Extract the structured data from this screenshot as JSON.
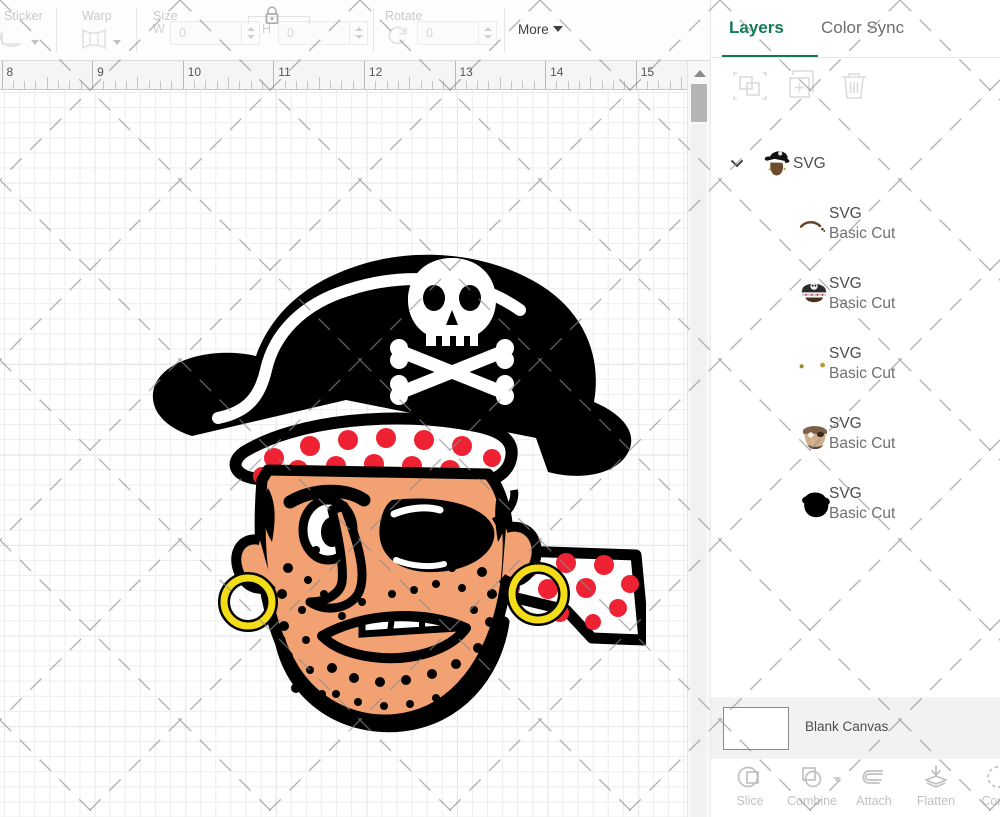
{
  "toolbar": {
    "groups": [
      {
        "label": "Sticker",
        "icon": "sticker-icon",
        "has_caret": true
      },
      {
        "label": "Warp",
        "icon": "warp-icon",
        "has_caret": true
      },
      {
        "label": "Size",
        "icon": "lock-icon"
      },
      {
        "label": "Rotate",
        "icon": "rotate-icon"
      }
    ],
    "size": {
      "label": "Size",
      "width_letter": "W",
      "width_value": "0",
      "height_letter": "H",
      "height_value": "0",
      "lock_icon": "lock-closed-icon"
    },
    "rotate": {
      "label": "Rotate",
      "value": "0",
      "icon": "rotate-icon"
    },
    "more_label": "More"
  },
  "ruler": {
    "unit": "inches",
    "marks": [
      "8",
      "9",
      "10",
      "11",
      "12",
      "13",
      "14",
      "15"
    ]
  },
  "canvas": {
    "artwork_name": "pirate-head-svg",
    "colors": {
      "skin": "#F2A172",
      "black": "#000000",
      "white": "#FFFFFF",
      "red": "#EE2233",
      "gold": "#F3DD18"
    }
  },
  "panel": {
    "tabs": [
      {
        "label": "Layers",
        "active": true
      },
      {
        "label": "Color Sync",
        "active": false
      }
    ],
    "actions": [
      {
        "name": "group-button",
        "icon": "group-icon",
        "enabled": false
      },
      {
        "name": "duplicate-button",
        "icon": "duplicate-icon",
        "enabled": false
      },
      {
        "name": "delete-button",
        "icon": "trash-icon",
        "enabled": false
      }
    ],
    "layers": [
      {
        "title": "SVG",
        "subtitle": "",
        "type": "group",
        "expanded": true,
        "thumb": "pirate-head-thumb"
      },
      {
        "title": "SVG",
        "subtitle": "Basic Cut",
        "type": "child",
        "thumb": "eyebrow-thumb"
      },
      {
        "title": "SVG",
        "subtitle": "Basic Cut",
        "type": "child",
        "thumb": "pirate-detail-thumb"
      },
      {
        "title": "SVG",
        "subtitle": "Basic Cut",
        "type": "child",
        "thumb": "earrings-thumb"
      },
      {
        "title": "SVG",
        "subtitle": "Basic Cut",
        "type": "child",
        "thumb": "face-thumb"
      },
      {
        "title": "SVG",
        "subtitle": "Basic Cut",
        "type": "child",
        "thumb": "silhouette-thumb"
      }
    ],
    "canvas_row": {
      "label": "Blank Canvas",
      "swatch_color": "#FFFFFF"
    },
    "bottom_tools": [
      {
        "label": "Slice",
        "icon": "slice-icon",
        "has_caret": false
      },
      {
        "label": "Combine",
        "icon": "combine-icon",
        "has_caret": true
      },
      {
        "label": "Attach",
        "icon": "attach-icon",
        "has_caret": false
      },
      {
        "label": "Flatten",
        "icon": "flatten-icon",
        "has_caret": false
      },
      {
        "label": "Conto",
        "icon": "contour-icon",
        "has_caret": false
      }
    ]
  }
}
